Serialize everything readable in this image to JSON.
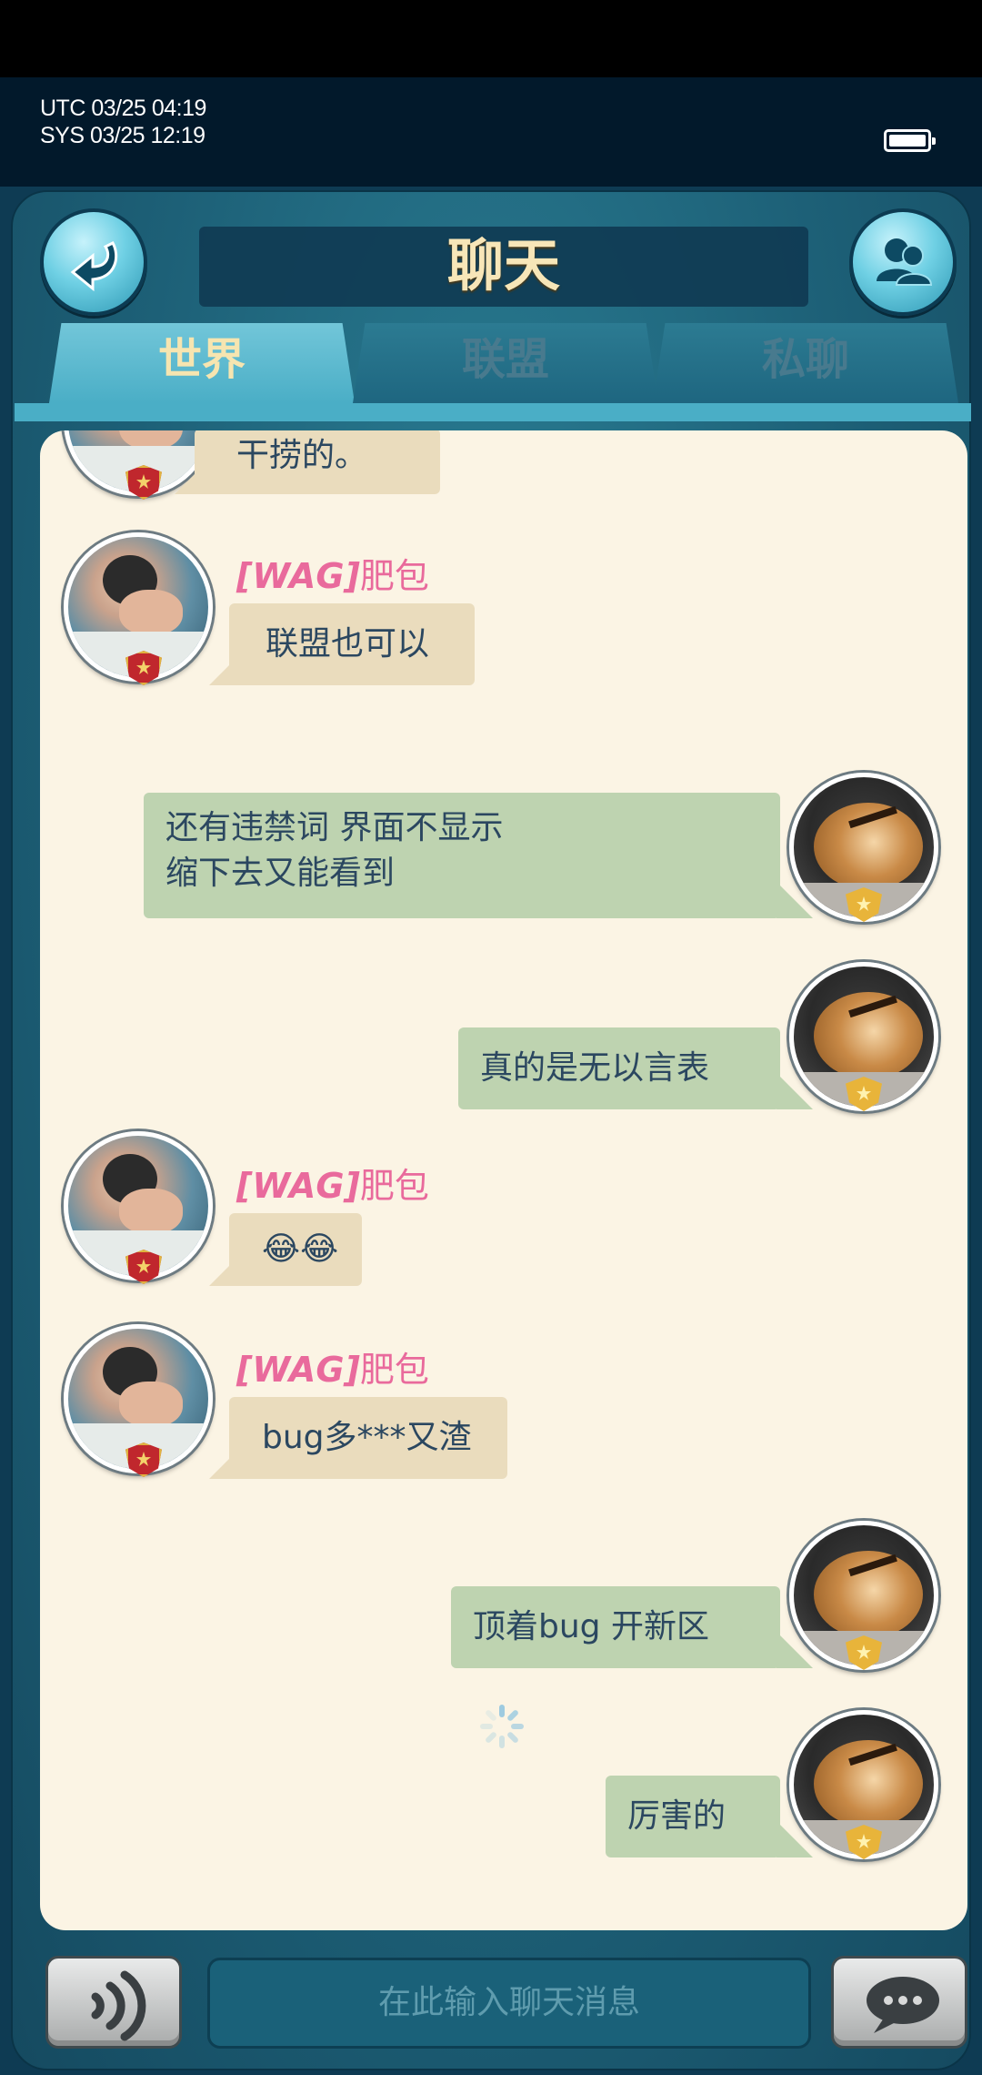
{
  "status": {
    "utc": "UTC 03/25 04:19",
    "sys": "SYS 03/25 12:19"
  },
  "header": {
    "title": "聊天",
    "back_icon": "back-arrow-icon",
    "friends_icon": "friends-icon"
  },
  "tabs": [
    {
      "label": "世界",
      "active": true
    },
    {
      "label": "联盟",
      "active": false
    },
    {
      "label": "私聊",
      "active": false
    }
  ],
  "messages": [
    {
      "side": "in",
      "text": "干捞的。",
      "partial": true
    },
    {
      "side": "in",
      "tag": "[WAG]",
      "name": "肥包",
      "text": "联盟也可以"
    },
    {
      "side": "out",
      "text": "还有违禁词  界面不显示",
      "text2": "缩下去又能看到"
    },
    {
      "side": "out",
      "text": "真的是无以言表"
    },
    {
      "side": "in",
      "tag": "[WAG]",
      "name": "肥包",
      "text": "😂😂"
    },
    {
      "side": "in",
      "tag": "[WAG]",
      "name": "肥包",
      "text": "bug多***又渣"
    },
    {
      "side": "out",
      "text": "顶着bug  开新区"
    },
    {
      "side": "out",
      "text": "厉害的"
    }
  ],
  "input": {
    "placeholder": "在此输入聊天消息"
  },
  "buttons": {
    "voice_icon": "voice-icon",
    "send_icon": "chat-bubble-icon"
  },
  "colors": {
    "incoming_bubble": "#eadcbd",
    "outgoing_bubble": "#bed3b0",
    "name": "#e96a9c",
    "active_tab_text": "#f6e5b0"
  }
}
